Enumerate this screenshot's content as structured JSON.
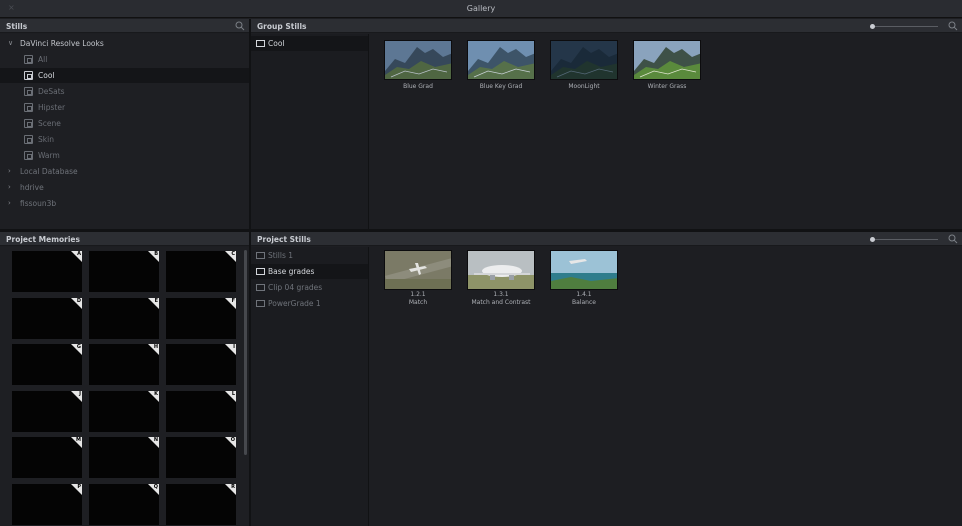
{
  "window": {
    "title": "Gallery",
    "close_glyph": "×"
  },
  "stills_panel": {
    "title": "Stills",
    "tree": [
      {
        "label": "DaVinci Resolve Looks",
        "kind": "top",
        "expanded": true
      },
      {
        "label": "All",
        "kind": "child"
      },
      {
        "label": "Cool",
        "kind": "child",
        "selected": true
      },
      {
        "label": "DeSats",
        "kind": "child"
      },
      {
        "label": "Hipster",
        "kind": "child"
      },
      {
        "label": "Scene",
        "kind": "child"
      },
      {
        "label": "Skin",
        "kind": "child"
      },
      {
        "label": "Warm",
        "kind": "child"
      },
      {
        "label": "Local Database",
        "kind": "root"
      },
      {
        "label": "hdrive",
        "kind": "root"
      },
      {
        "label": "fissoun3b",
        "kind": "root"
      }
    ]
  },
  "group_stills": {
    "title": "Group Stills",
    "albums": [
      {
        "label": "Cool",
        "selected": true
      }
    ],
    "stills": [
      {
        "label": "Blue Grad",
        "scene": "mountain-blue"
      },
      {
        "label": "Blue Key Grad",
        "scene": "mountain-bluekey"
      },
      {
        "label": "MoonLight",
        "scene": "mountain-moon"
      },
      {
        "label": "Winter Grass",
        "scene": "mountain-green"
      }
    ]
  },
  "project_memories": {
    "title": "Project Memories",
    "keys": [
      "A",
      "B",
      "C",
      "D",
      "E",
      "F",
      "G",
      "H",
      "I",
      "J",
      "K",
      "L",
      "M",
      "N",
      "O",
      "P",
      "Q",
      "R"
    ]
  },
  "project_stills": {
    "title": "Project Stills",
    "albums": [
      {
        "label": "Stills 1",
        "selected": false
      },
      {
        "label": "Base grades",
        "selected": true
      },
      {
        "label": "Clip 04 grades",
        "selected": false
      },
      {
        "label": "PowerGrade 1",
        "selected": false
      }
    ],
    "stills": [
      {
        "id": "1.2.1",
        "label": "Match",
        "scene": "aerial-plane"
      },
      {
        "id": "1.3.1",
        "label": "Match and Contrast",
        "scene": "airliner"
      },
      {
        "id": "1.4.1",
        "label": "Balance",
        "scene": "plane-coast"
      }
    ]
  },
  "colors": {
    "background": "#1d1e22",
    "header": "#2c2e33",
    "selected": "#141518",
    "text": "#a8abb1"
  }
}
